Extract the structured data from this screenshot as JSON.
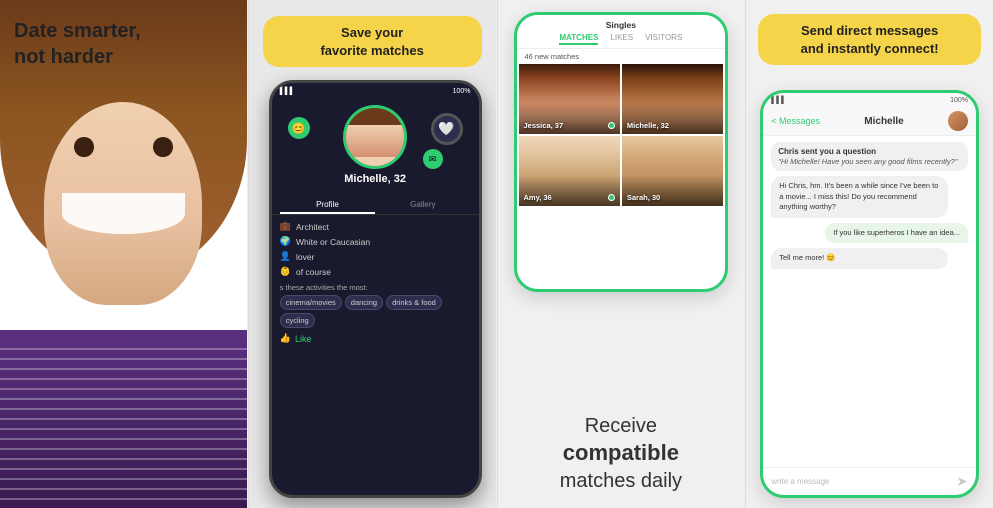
{
  "panel1": {
    "headline_line1": "Date smarter,",
    "headline_line2": "not harder"
  },
  "panel2": {
    "bubble_text_line1": "Save your",
    "bubble_text_bold": "favorite",
    "bubble_text_line2": "matches",
    "profile_name": "Michelle, 32",
    "tab_profile": "Profile",
    "tab_gallery": "Gallery",
    "occupation": "Architect",
    "ethnicity": "White or Caucasian",
    "status": "lover",
    "kids": "of course",
    "activities_label": "s these activities the most:",
    "tags": [
      "cinema/movies",
      "dancing",
      "drinks & food",
      "cycling"
    ],
    "like_label": "Like"
  },
  "panel3": {
    "nav_title": "Singles",
    "tab_matches": "MATCHES",
    "tab_likes": "LIKES",
    "tab_visitors": "VISITORS",
    "new_matches_count": "46 new matches",
    "persons": [
      {
        "name": "Jessica, 37",
        "online": true
      },
      {
        "name": "Michelle, 32",
        "online": false
      },
      {
        "name": "Amy, 36",
        "online": true
      },
      {
        "name": "Sarah, 30",
        "online": false
      },
      {
        "name": "",
        "online": false
      },
      {
        "name": "",
        "online": false
      }
    ],
    "caption_line1": "Receive",
    "caption_bold": "compatible",
    "caption_line2": "matches daily"
  },
  "panel4": {
    "bubble_line1": "Send",
    "bubble_bold": "direct messages",
    "bubble_line2": "and instantly connect!",
    "header_back": "< Messages",
    "header_name": "Michelle",
    "status_bar_signal": "▌▌▌",
    "status_bar_battery": "100%",
    "question_sender": "Chris sent you a question",
    "question_text": "\"Hi Michelle! Have you seen any good films recently?\"",
    "chat_messages": [
      {
        "type": "received",
        "text": "Hi Chris, hm. It's been a while since I've been to a movie... I miss this! Do you recommend anything worthy?"
      },
      {
        "type": "sent",
        "text": "If you like superheros I have an idea..."
      },
      {
        "type": "received",
        "text": "Tell me more! 😊"
      }
    ],
    "write_placeholder": "write a message"
  }
}
